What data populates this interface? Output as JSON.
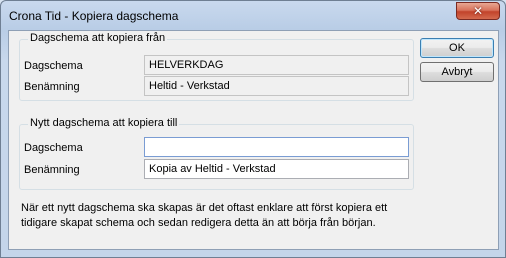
{
  "window": {
    "title": "Crona Tid - Kopiera dagschema",
    "close_glyph": "✕"
  },
  "copy_from": {
    "legend": "Dagschema att kopiera från",
    "dagschema_label": "Dagschema",
    "dagschema_value": "HELVERKDAG",
    "benamning_label": "Benämning",
    "benamning_value": "Heltid - Verkstad"
  },
  "copy_to": {
    "legend": "Nytt dagschema att kopiera till",
    "dagschema_label": "Dagschema",
    "dagschema_value": "",
    "benamning_label": "Benämning",
    "benamning_value": "Kopia av Heltid - Verkstad"
  },
  "buttons": {
    "ok": "OK",
    "cancel": "Avbryt"
  },
  "info_text": "När ett nytt dagschema ska skapas är det oftast enklare att först kopiera ett tidigare skapat schema och sedan redigera detta än att börja från början."
}
